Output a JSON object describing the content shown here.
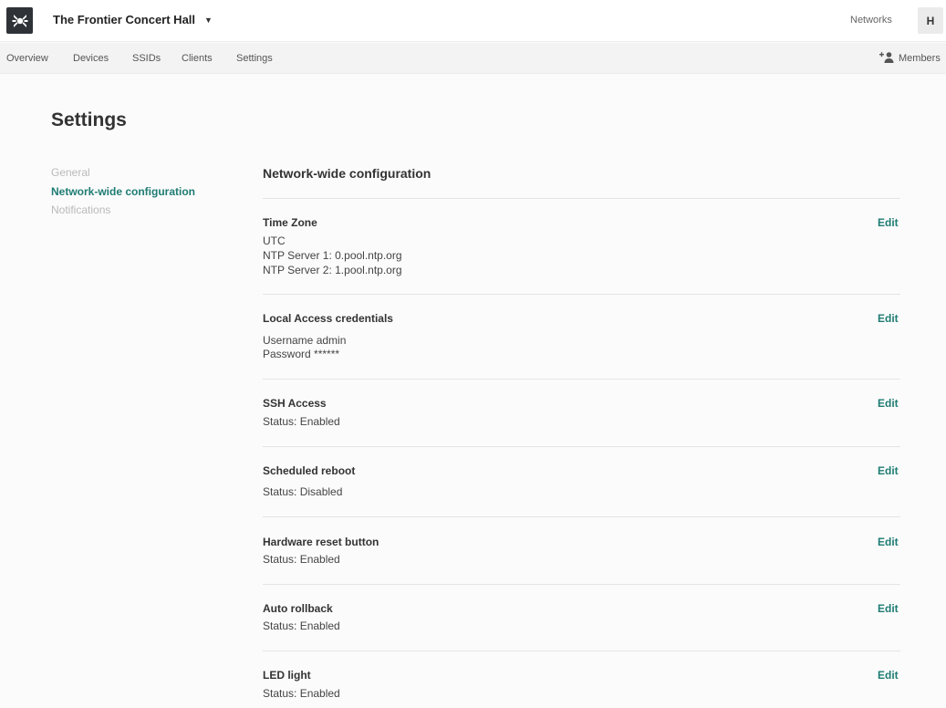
{
  "header": {
    "logo_icon": "network-logo-icon",
    "network_name": "The Frontier Concert Hall",
    "networks_label": "Networks",
    "avatar_initial": "H"
  },
  "nav": {
    "tabs": [
      "Overview",
      "Devices",
      "SSIDs",
      "Clients",
      "Settings"
    ],
    "members_label": "Members",
    "members_icon": "add-person-icon"
  },
  "page": {
    "title": "Settings"
  },
  "sidebar": {
    "items": [
      {
        "label": "General",
        "active": false
      },
      {
        "label": "Network-wide configuration",
        "active": true
      },
      {
        "label": "Notifications",
        "active": false
      }
    ]
  },
  "main": {
    "section_title": "Network-wide configuration",
    "edit_label": "Edit",
    "items": [
      {
        "title": "Time Zone",
        "lines": [
          "UTC",
          "NTP Server 1: 0.pool.ntp.org",
          "NTP Server 2: 1.pool.ntp.org"
        ]
      },
      {
        "title": "Local Access credentials",
        "lines": [
          "Username admin",
          "Password ******"
        ]
      },
      {
        "title": "SSH Access",
        "lines": [
          "Status: Enabled"
        ]
      },
      {
        "title": "Scheduled reboot",
        "lines": [
          "Status: Disabled"
        ]
      },
      {
        "title": "Hardware reset button",
        "lines": [
          "Status: Enabled"
        ]
      },
      {
        "title": "Auto rollback",
        "lines": [
          "Status: Enabled"
        ]
      },
      {
        "title": "LED light",
        "lines": [
          "Status: Enabled"
        ]
      }
    ]
  },
  "colors": {
    "accent": "#1e7c73",
    "logo_bg": "#2f3337"
  }
}
